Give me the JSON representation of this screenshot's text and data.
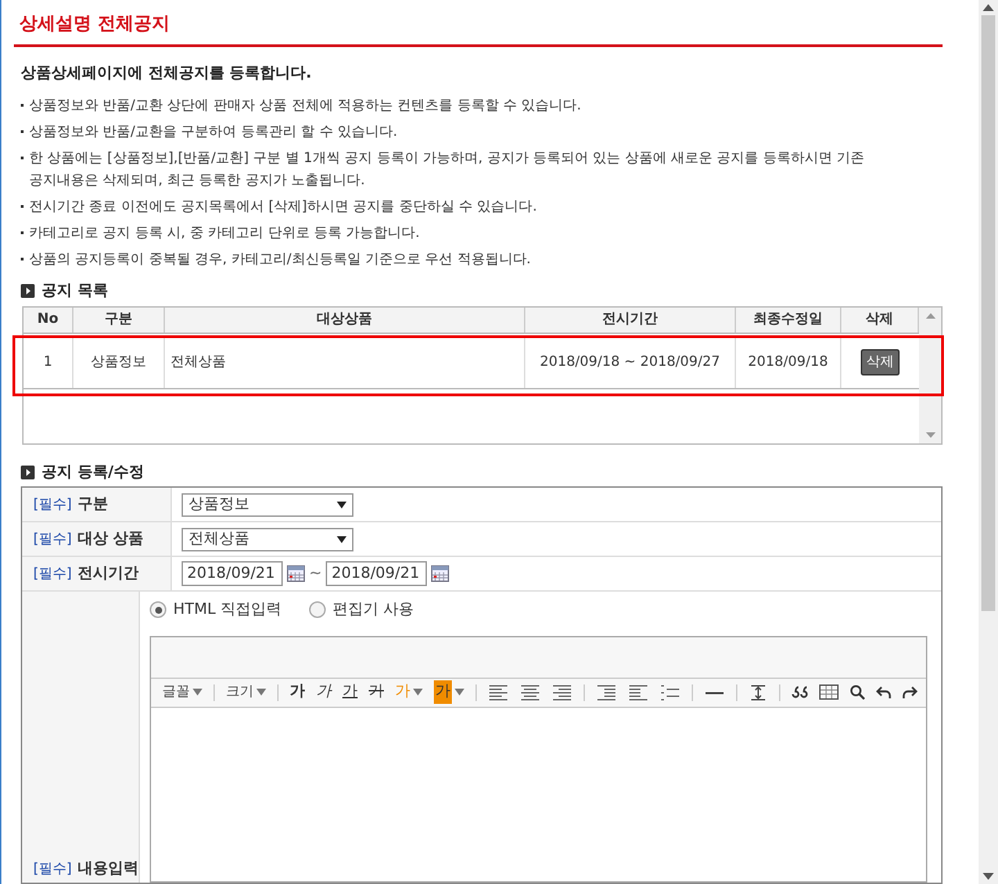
{
  "title": "상세설명 전체공지",
  "intro": "상품상세페이지에 전체공지를 등록합니다.",
  "notes": [
    [
      "상품정보와 반품/교환 상단에 판매자 상품 전체에 적용하는 컨텐츠를 등록할 수 있습니다."
    ],
    [
      "상품정보와 반품/교환을 구분하여 등록관리 할 수 있습니다."
    ],
    [
      "한 상품에는 [상품정보],[반품/교환] 구분 별 1개씩 공지 등록이 가능하며, 공지가 등록되어 있는 상품에 새로운 공지를 등록하시면 기존",
      "공지내용은 삭제되며, 최근 등록한 공지가 노출됩니다."
    ],
    [
      "전시기간 종료 이전에도 공지목록에서 [삭제]하시면 공지를 중단하실 수 있습니다."
    ],
    [
      "카테고리로 공지 등록 시, 중 카테고리 단위로 등록 가능합니다."
    ],
    [
      "상품의 공지등록이 중복될 경우, 카테고리/최신등록일 기준으로 우선 적용됩니다."
    ]
  ],
  "notice_list": {
    "heading": "공지 목록",
    "columns": [
      "No",
      "구분",
      "대상상품",
      "전시기간",
      "최종수정일",
      "삭제"
    ],
    "rows": [
      {
        "cells": [
          "1",
          "상품정보",
          "전체상품",
          "2018/09/18 ~ 2018/09/27",
          "2018/09/18"
        ],
        "action": "삭제",
        "highlighted": true
      }
    ]
  },
  "form": {
    "heading": "공지 등록/수정",
    "fields": [
      {
        "kind": "select",
        "tag": "[필수]",
        "label": "구분",
        "value": "상품정보"
      },
      {
        "kind": "select",
        "tag": "[필수]",
        "label": "대상 상품",
        "value": "전체상품"
      },
      {
        "kind": "daterange",
        "tag": "[필수]",
        "label": "전시기간",
        "start": "2018/09/21",
        "separator": "~",
        "end": "2018/09/21"
      }
    ],
    "input_modes": [
      {
        "label": "HTML 직접입력",
        "selected": true
      },
      {
        "label": "편집기 사용",
        "selected": false
      }
    ],
    "toolbar": [
      {
        "kind": "menu",
        "label": "글꼴"
      },
      {
        "kind": "menu",
        "label": "크기"
      },
      {
        "kind": "bold",
        "label": "가"
      },
      {
        "kind": "italic",
        "label": "가"
      },
      {
        "kind": "underline",
        "label": "가"
      },
      {
        "kind": "strike",
        "label": "가"
      },
      {
        "kind": "color",
        "label": "가"
      },
      {
        "kind": "highlight",
        "label": "가"
      }
    ],
    "content_field": {
      "tag": "[필수]",
      "label": "내용입력"
    }
  }
}
